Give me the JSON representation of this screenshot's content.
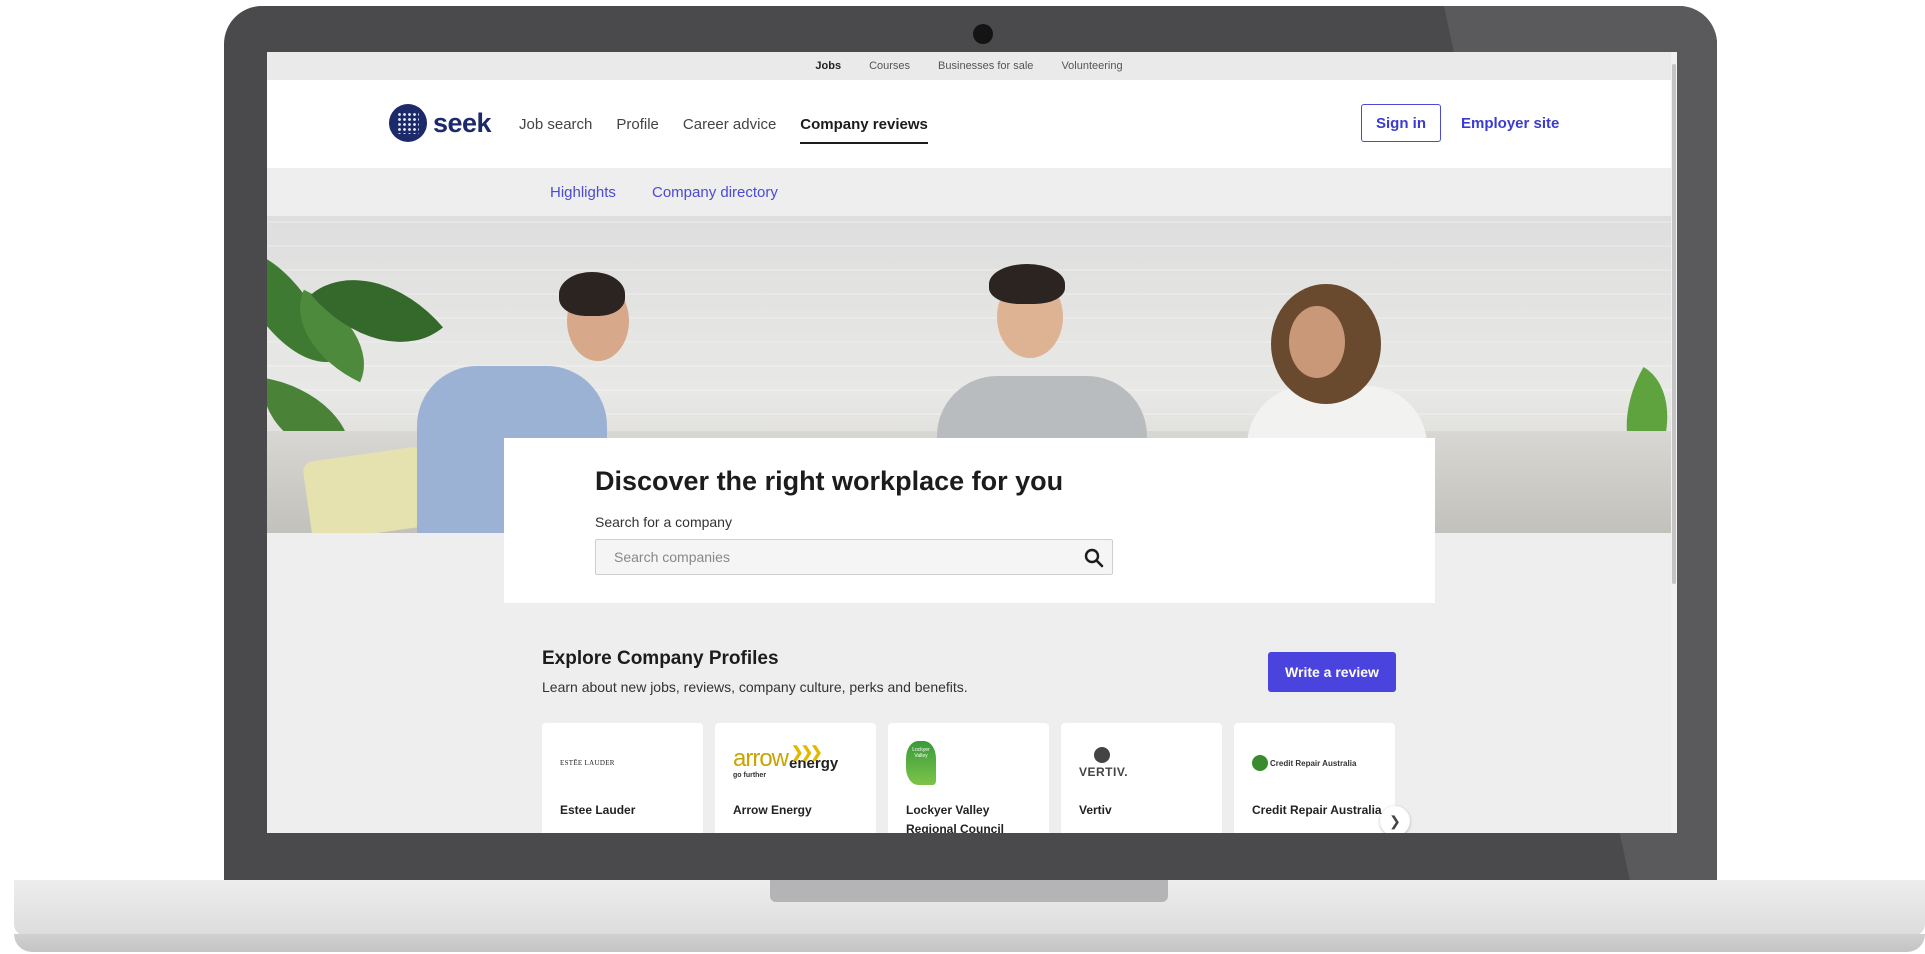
{
  "topbar": {
    "items": [
      "Jobs",
      "Courses",
      "Businesses for sale",
      "Volunteering"
    ]
  },
  "header": {
    "logo_text": "seek",
    "nav": [
      "Job search",
      "Profile",
      "Career advice",
      "Company reviews"
    ],
    "signin_label": "Sign in",
    "employer_label": "Employer site"
  },
  "subnav": {
    "items": [
      "Highlights",
      "Company directory"
    ]
  },
  "hero": {
    "title": "Discover the right workplace for you",
    "search_label": "Search for a company",
    "search_placeholder": "Search companies"
  },
  "explore": {
    "title": "Explore Company Profiles",
    "subtitle": "Learn about new jobs, reviews, company culture, perks and benefits.",
    "write_review_label": "Write a review"
  },
  "companies": [
    {
      "name": "Estee Lauder",
      "logo_text": "ESTĒE LAUDER"
    },
    {
      "name": "Arrow Energy",
      "logo_text": "arrow",
      "logo_text_2": "energy",
      "logo_tagline": "go further"
    },
    {
      "name": "Lockyer Valley Regional Council",
      "logo_text": "Lockyer Valley"
    },
    {
      "name": "Vertiv",
      "logo_text": "VERTIV."
    },
    {
      "name": "Credit Repair Australia",
      "logo_text": "Credit Repair Australia"
    }
  ],
  "colors": {
    "brand": "#1c2a6b",
    "accent": "#4a43dd",
    "link": "#4a4ad6",
    "arrow_yellow": "#c9a400"
  }
}
